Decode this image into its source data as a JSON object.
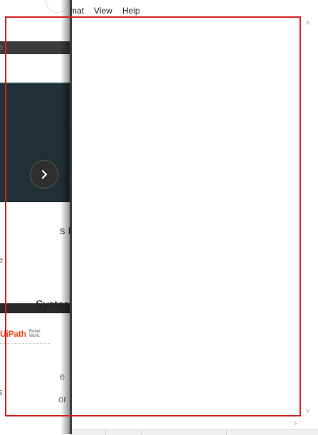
{
  "background_page": {
    "text_fragments": [
      "e",
      "s F",
      "e",
      "e",
      "or",
      "s"
    ],
    "section_heading": "Syster",
    "logo": {
      "name": "UiPath",
      "tagline_line1": "Robot",
      "tagline_line2": "Work."
    },
    "next_button_glyph": "›",
    "hero_color": "#1f3136",
    "brand_color": "#fa4616"
  },
  "notepad": {
    "menu": [
      "mat",
      "View",
      "Help"
    ],
    "editor_text": "",
    "scrollbar": {
      "up_arrow": "˄",
      "down_arrow": "˅",
      "right_arrow": "›"
    }
  },
  "overlay": {
    "selection_color": "#d32020"
  }
}
